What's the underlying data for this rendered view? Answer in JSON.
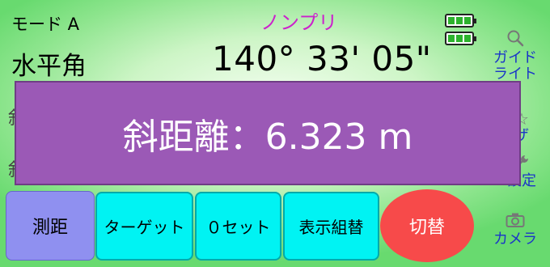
{
  "header": {
    "mode": "モード A",
    "prism": "ノンプリ"
  },
  "measure": {
    "hangle_label": "水平角",
    "hangle_value": "140° 33' 05\""
  },
  "peek": {
    "row1": "斜",
    "row2": "斜"
  },
  "sidebar": {
    "guide_line1": "ガイド",
    "guide_line2": "ライト",
    "partial1": "ザ",
    "settings": "設定",
    "camera": "カメラ"
  },
  "overlay": {
    "text": "斜距離：6.323 m"
  },
  "buttons": {
    "measure": "測距",
    "target": "ターゲット",
    "zero_set": "０セット",
    "display_swap": "表示組替",
    "switch": "切替"
  },
  "colors": {
    "overlay": "#9b59b6",
    "measure_button": "#8f90f0",
    "cyan_buttons": "#00f3f3",
    "switch_button": "#f74a4a",
    "prism_text": "#cc22cc",
    "sidebar_text": "#1a35c8"
  },
  "icons": {
    "guide": "search-icon",
    "partial1": "star-icon",
    "settings": "wrench-icon",
    "camera": "camera-icon",
    "battery": "battery-full-icon"
  }
}
